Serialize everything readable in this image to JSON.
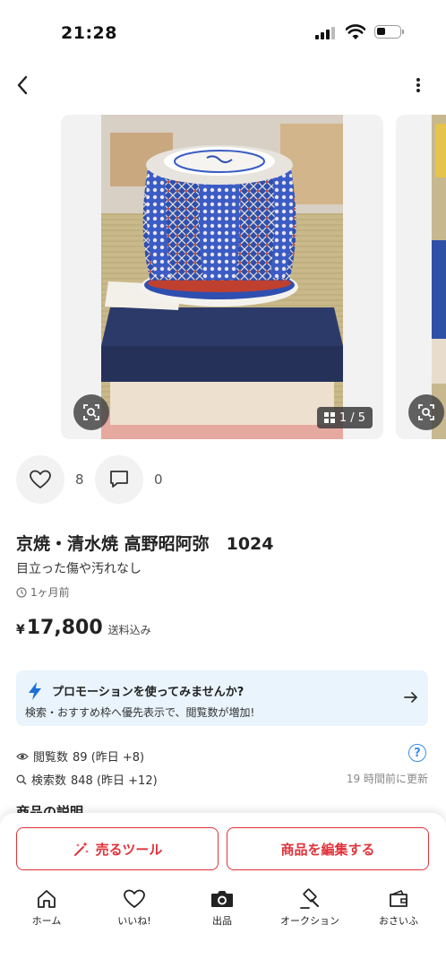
{
  "status": {
    "time": "21:28"
  },
  "carousel": {
    "counter": "1 / 5"
  },
  "actions": {
    "likes": "8",
    "comments": "0"
  },
  "item": {
    "title": "京焼・清水焼 高野昭阿弥　1024",
    "condition": "目立った傷や汚れなし",
    "posted": "1ヶ月前",
    "price_yen": "¥",
    "price": "17,800",
    "shipping": "送料込み"
  },
  "promo": {
    "title": "プロモーションを使ってみませんか?",
    "description": "検索・おすすめ枠へ優先表示で、閲覧数が増加!"
  },
  "stats": {
    "views_label": "閲覧数",
    "views_value": "89 (昨日 +8)",
    "search_label": "検索数",
    "search_value": "848 (昨日 +12)",
    "updated": "19 時間前に更新"
  },
  "section_peek": "商品の説明",
  "buttons": {
    "sell_tool": "売るツール",
    "edit_item": "商品を編集する"
  },
  "tabs": [
    {
      "label": "ホーム",
      "icon": "home-icon"
    },
    {
      "label": "いいね!",
      "icon": "heart-icon"
    },
    {
      "label": "出品",
      "icon": "camera-icon"
    },
    {
      "label": "オークション",
      "icon": "gavel-icon"
    },
    {
      "label": "おさいふ",
      "icon": "wallet-icon"
    }
  ],
  "colors": {
    "accent_red": "#e0323a",
    "promo_bg": "#e9f4fd",
    "link_blue": "#3a8ee6"
  }
}
